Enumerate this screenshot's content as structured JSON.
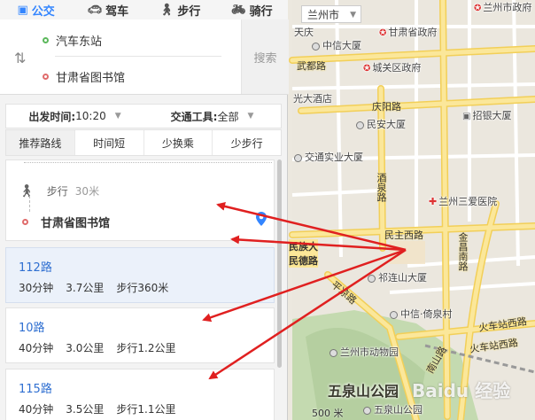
{
  "mode_tabs": [
    {
      "label": "公交",
      "icon": "bus-icon"
    },
    {
      "label": "驾车",
      "icon": "car-icon"
    },
    {
      "label": "步行",
      "icon": "walk-icon"
    },
    {
      "label": "骑行",
      "icon": "bike-icon"
    }
  ],
  "route": {
    "start": "汽车东站",
    "end": "甘肃省图书馆",
    "search_label": "搜索"
  },
  "options": {
    "depart_label": "出发时间:",
    "depart_value": "10:20",
    "vehicle_label": "交通工具:",
    "vehicle_value": "全部"
  },
  "sort_tabs": [
    "推荐路线",
    "时间短",
    "少换乘",
    "少步行"
  ],
  "detail": {
    "walk_label": "步行",
    "walk_distance": "30米",
    "destination": "甘肃省图书馆"
  },
  "results": [
    {
      "name": "112路",
      "time": "30分钟",
      "distance": "3.7公里",
      "walk": "步行360米",
      "active": true
    },
    {
      "name": "10路",
      "time": "40分钟",
      "distance": "3.0公里",
      "walk": "步行1.2公里",
      "active": false
    },
    {
      "name": "115路",
      "time": "40分钟",
      "distance": "3.5公里",
      "walk": "步行1.1公里",
      "active": false
    }
  ],
  "map": {
    "city": "兰州市",
    "scale": "500 米",
    "watermark": "Baidu 经验",
    "labels": {
      "govt_city": "兰州市政府",
      "tianqing": "天庆",
      "zhongxin": "中信大厦",
      "gansu_govt": "甘肃省政府",
      "wudu_road": "武都路",
      "chengguan_govt": "城关区政府",
      "guangda_hotel": "光大酒店",
      "qingyang_road": "庆阳路",
      "minan_bldg": "民安大厦",
      "zhaoyin_bldg": "招银大厦",
      "jiaotong_bldg": "交通实业大厦",
      "jiuquan_road": "酒泉路",
      "sanai_hospital": "兰州三爱医院",
      "minzhu_west": "民主西路",
      "jinchang_south": "金昌南路",
      "minzu_road": "民族大\n民德路",
      "qilianshan": "祁连山大厦",
      "pingliang_road": "平凉路",
      "zhongxin_yishang": "中信·倚泉村",
      "huoche_west": "火车站西路",
      "huoche_road": "火车站西路",
      "zoo": "兰州市动物园",
      "nanshan_road": "南山路",
      "park": "五泉山公园",
      "park_poi": "五泉山公园"
    }
  },
  "colors": {
    "accent": "#3385ff",
    "route_link": "#2f6fd1",
    "arrow": "#e02020",
    "main_road": "#f7d96a",
    "park_green": "#c4dab0"
  }
}
